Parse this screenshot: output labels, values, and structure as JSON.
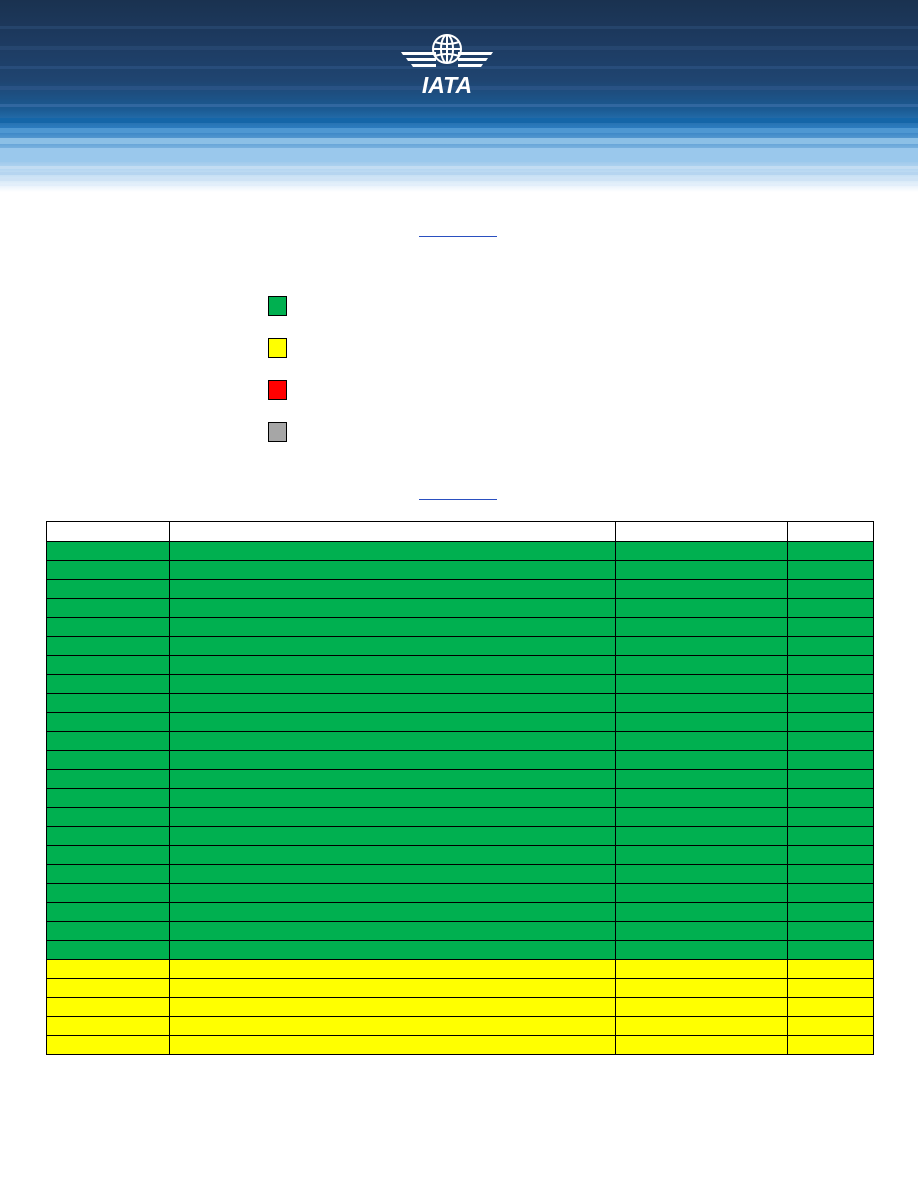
{
  "header": {
    "logo_text": "IATA",
    "colors": {
      "banner_dark": "#1d3a60",
      "banner_light": "#a9cfee",
      "logo": "#ffffff"
    }
  },
  "links": {
    "top_link": "",
    "table_link": ""
  },
  "legend": [
    {
      "color": "#00b050",
      "label": ""
    },
    {
      "color": "#ffff00",
      "label": ""
    },
    {
      "color": "#ff0000",
      "label": ""
    },
    {
      "color": "#a6a6a6",
      "label": ""
    }
  ],
  "table": {
    "columns": [
      "",
      "",
      "",
      ""
    ],
    "rows": [
      {
        "status": "green",
        "color": "#00b050",
        "cells": [
          "",
          "",
          "",
          ""
        ]
      },
      {
        "status": "green",
        "color": "#00b050",
        "cells": [
          "",
          "",
          "",
          ""
        ]
      },
      {
        "status": "green",
        "color": "#00b050",
        "cells": [
          "",
          "",
          "",
          ""
        ]
      },
      {
        "status": "green",
        "color": "#00b050",
        "cells": [
          "",
          "",
          "",
          ""
        ]
      },
      {
        "status": "green",
        "color": "#00b050",
        "cells": [
          "",
          "",
          "",
          ""
        ]
      },
      {
        "status": "green",
        "color": "#00b050",
        "cells": [
          "",
          "",
          "",
          ""
        ]
      },
      {
        "status": "green",
        "color": "#00b050",
        "cells": [
          "",
          "",
          "",
          ""
        ]
      },
      {
        "status": "green",
        "color": "#00b050",
        "cells": [
          "",
          "",
          "",
          ""
        ]
      },
      {
        "status": "green",
        "color": "#00b050",
        "cells": [
          "",
          "",
          "",
          ""
        ]
      },
      {
        "status": "green",
        "color": "#00b050",
        "cells": [
          "",
          "",
          "",
          ""
        ]
      },
      {
        "status": "green",
        "color": "#00b050",
        "cells": [
          "",
          "",
          "",
          ""
        ]
      },
      {
        "status": "green",
        "color": "#00b050",
        "cells": [
          "",
          "",
          "",
          ""
        ]
      },
      {
        "status": "green",
        "color": "#00b050",
        "cells": [
          "",
          "",
          "",
          ""
        ]
      },
      {
        "status": "green",
        "color": "#00b050",
        "cells": [
          "",
          "",
          "",
          ""
        ]
      },
      {
        "status": "green",
        "color": "#00b050",
        "cells": [
          "",
          "",
          "",
          ""
        ]
      },
      {
        "status": "green",
        "color": "#00b050",
        "cells": [
          "",
          "",
          "",
          ""
        ]
      },
      {
        "status": "green",
        "color": "#00b050",
        "cells": [
          "",
          "",
          "",
          ""
        ]
      },
      {
        "status": "green",
        "color": "#00b050",
        "cells": [
          "",
          "",
          "",
          ""
        ]
      },
      {
        "status": "green",
        "color": "#00b050",
        "cells": [
          "",
          "",
          "",
          ""
        ]
      },
      {
        "status": "green",
        "color": "#00b050",
        "cells": [
          "",
          "",
          "",
          ""
        ]
      },
      {
        "status": "green",
        "color": "#00b050",
        "cells": [
          "",
          "",
          "",
          ""
        ]
      },
      {
        "status": "green",
        "color": "#00b050",
        "cells": [
          "",
          "",
          "",
          ""
        ]
      },
      {
        "status": "yellow",
        "color": "#ffff00",
        "cells": [
          "",
          "",
          "",
          ""
        ]
      },
      {
        "status": "yellow",
        "color": "#ffff00",
        "cells": [
          "",
          "",
          "",
          ""
        ]
      },
      {
        "status": "yellow",
        "color": "#ffff00",
        "cells": [
          "",
          "",
          "",
          ""
        ]
      },
      {
        "status": "yellow",
        "color": "#ffff00",
        "cells": [
          "",
          "",
          "",
          ""
        ]
      },
      {
        "status": "yellow",
        "color": "#ffff00",
        "cells": [
          "",
          "",
          "",
          ""
        ]
      }
    ]
  }
}
